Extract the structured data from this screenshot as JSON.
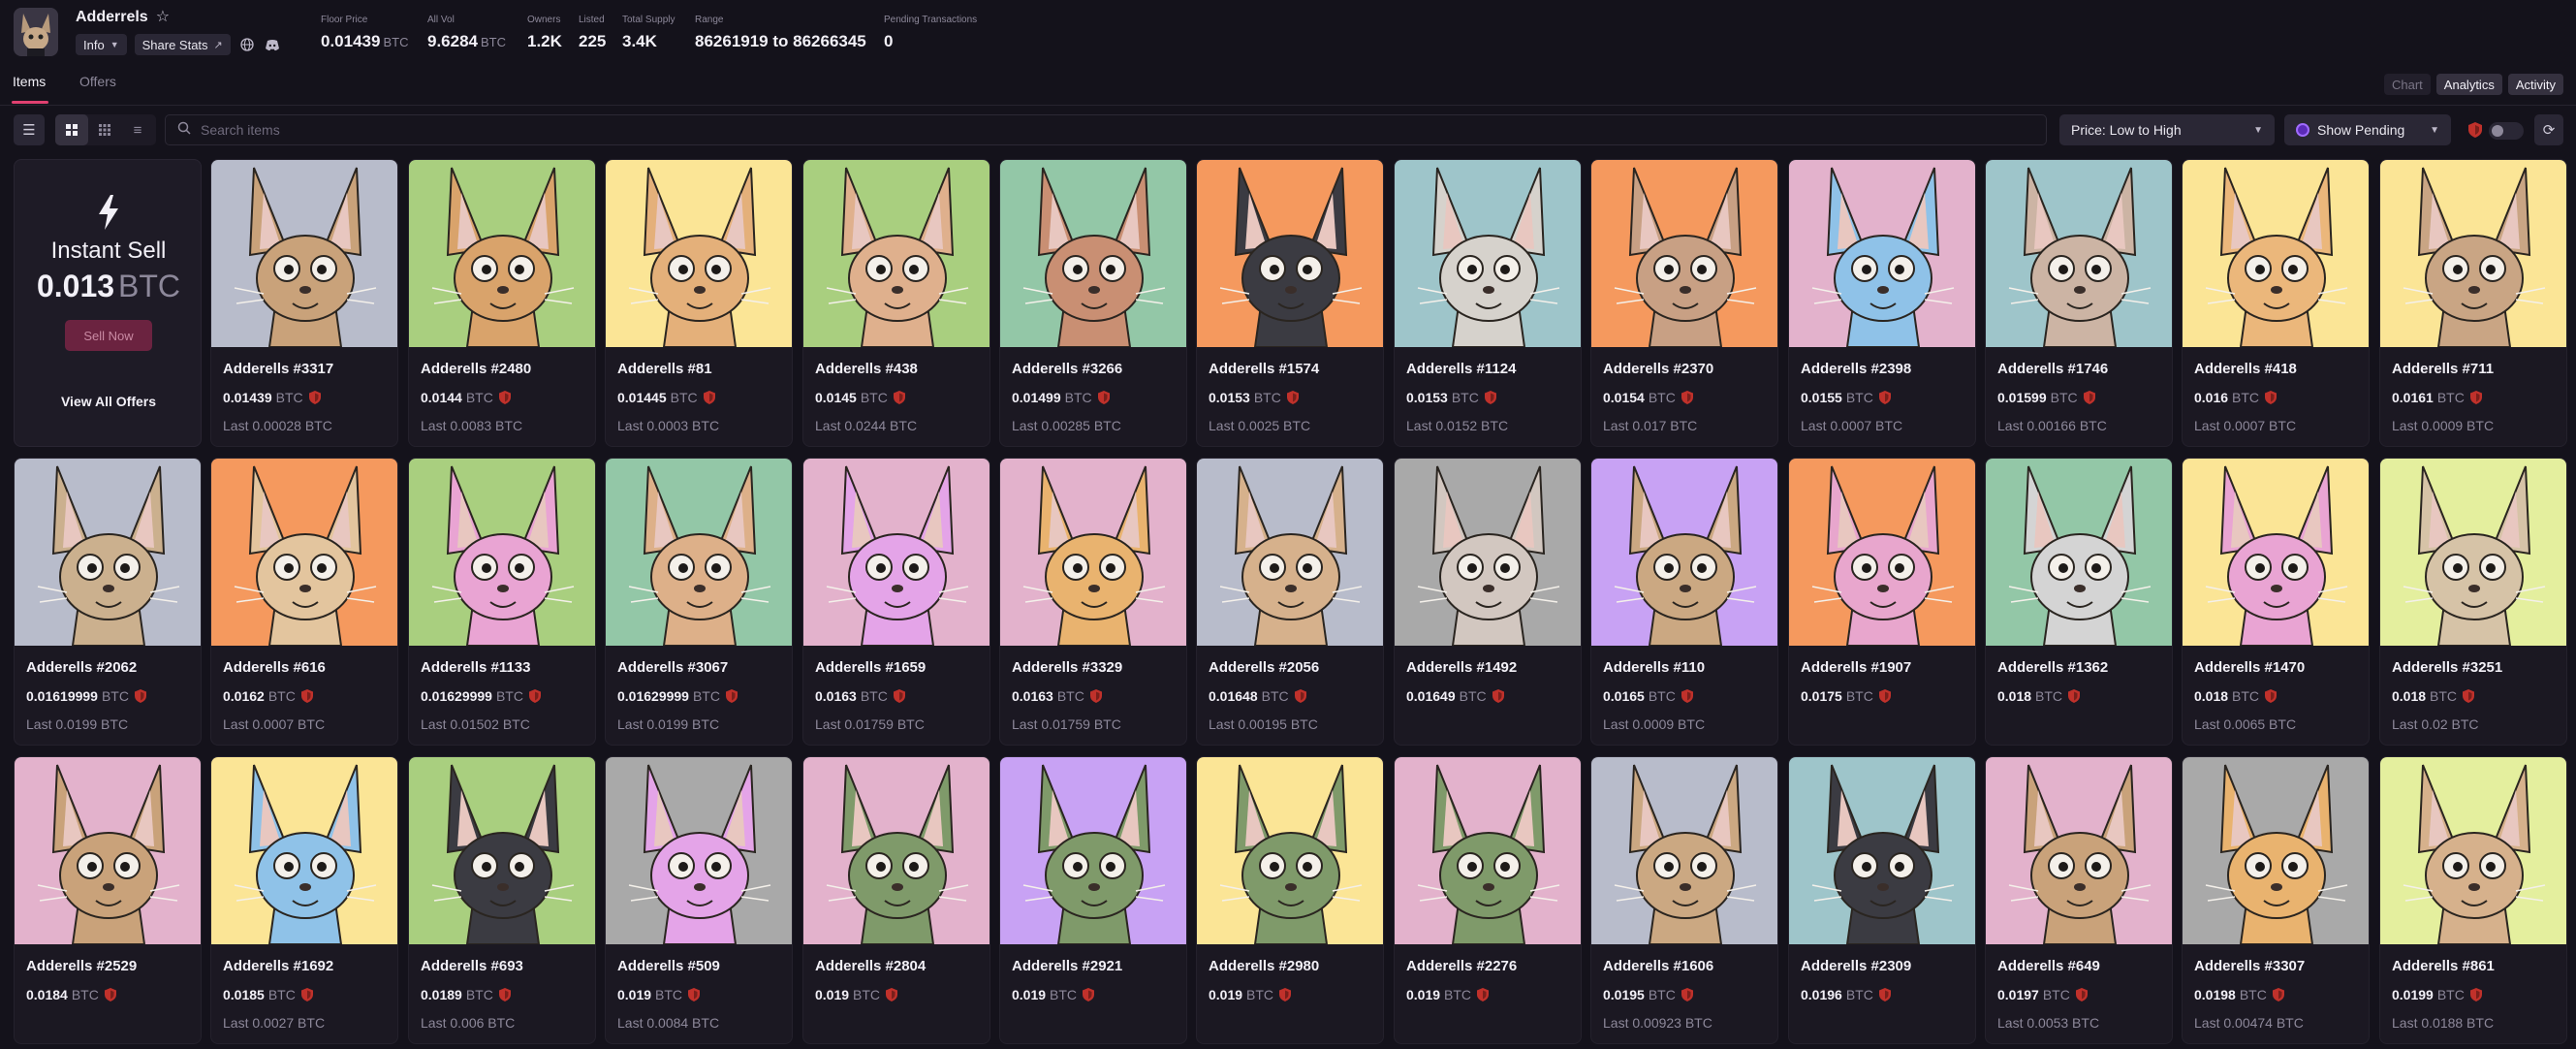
{
  "collection": {
    "name": "Adderrels",
    "info_label": "Info",
    "share_label": "Share Stats"
  },
  "stats": [
    {
      "label": "Floor Price",
      "value": "0.01439",
      "unit": "BTC"
    },
    {
      "label": "All Vol",
      "value": "9.6284",
      "unit": "BTC"
    },
    {
      "label": "Owners",
      "value": "1.2K",
      "unit": ""
    },
    {
      "label": "Listed",
      "value": "225",
      "unit": ""
    },
    {
      "label": "Total Supply",
      "value": "3.4K",
      "unit": ""
    },
    {
      "label": "Range",
      "value": "86261919 to 86266345",
      "unit": ""
    },
    {
      "label": "Pending Transactions",
      "value": "0",
      "unit": ""
    }
  ],
  "tabs": [
    {
      "label": "Items"
    },
    {
      "label": "Offers"
    }
  ],
  "view_tabs": [
    {
      "label": "Chart"
    },
    {
      "label": "Analytics"
    },
    {
      "label": "Activity"
    }
  ],
  "search": {
    "placeholder": "Search items"
  },
  "sort_select": {
    "value": "Price: Low to High"
  },
  "pending_select": {
    "value": "Show Pending"
  },
  "instant_sell": {
    "title": "Instant Sell",
    "price": "0.013",
    "unit": "BTC",
    "button": "Sell Now",
    "link": "View All Offers"
  },
  "colors": {
    "accent": "#e04070",
    "background": "#14121b",
    "card": "#1b1822",
    "shield": "#c0312b"
  },
  "items": [
    {
      "name": "Adderells #3317",
      "price": "0.01439",
      "unit": "BTC",
      "last": "Last 0.00028 BTC",
      "bg": "#b8bccb",
      "fur": "#c9a27a"
    },
    {
      "name": "Adderells #2480",
      "price": "0.0144",
      "unit": "BTC",
      "last": "Last 0.0083 BTC",
      "bg": "#a9cf7f",
      "fur": "#d9a36b"
    },
    {
      "name": "Adderells #81",
      "price": "0.01445",
      "unit": "BTC",
      "last": "Last 0.0003 BTC",
      "bg": "#fbe596",
      "fur": "#e4b07a"
    },
    {
      "name": "Adderells #438",
      "price": "0.0145",
      "unit": "BTC",
      "last": "Last 0.0244 BTC",
      "bg": "#a9cf7f",
      "fur": "#dfb08d"
    },
    {
      "name": "Adderells #3266",
      "price": "0.01499",
      "unit": "BTC",
      "last": "Last 0.00285 BTC",
      "bg": "#93c7a7",
      "fur": "#c98f73"
    },
    {
      "name": "Adderells #1574",
      "price": "0.0153",
      "unit": "BTC",
      "last": "Last 0.0025 BTC",
      "bg": "#f5995e",
      "fur": "#3b3b42"
    },
    {
      "name": "Adderells #1124",
      "price": "0.0153",
      "unit": "BTC",
      "last": "Last 0.0152 BTC",
      "bg": "#9ec5ca",
      "fur": "#d6d2cc"
    },
    {
      "name": "Adderells #2370",
      "price": "0.0154",
      "unit": "BTC",
      "last": "Last 0.017 BTC",
      "bg": "#f5995e",
      "fur": "#c8a084"
    },
    {
      "name": "Adderells #2398",
      "price": "0.0155",
      "unit": "BTC",
      "last": "Last 0.0007 BTC",
      "bg": "#e3b2cc",
      "fur": "#8fc2e8"
    },
    {
      "name": "Adderells #1746",
      "price": "0.01599",
      "unit": "BTC",
      "last": "Last 0.00166 BTC",
      "bg": "#9ec5ca",
      "fur": "#ccb4a4"
    },
    {
      "name": "Adderells #418",
      "price": "0.016",
      "unit": "BTC",
      "last": "Last 0.0007 BTC",
      "bg": "#fbe596",
      "fur": "#ebb77b"
    },
    {
      "name": "Adderells #711",
      "price": "0.0161",
      "unit": "BTC",
      "last": "Last 0.0009 BTC",
      "bg": "#fbe596",
      "fur": "#c9a584"
    },
    {
      "name": "Adderells #2062",
      "price": "0.01619999",
      "unit": "BTC",
      "last": "Last 0.0199 BTC",
      "bg": "#b8bccb",
      "fur": "#cbb08e"
    },
    {
      "name": "Adderells #616",
      "price": "0.0162",
      "unit": "BTC",
      "last": "Last 0.0007 BTC",
      "bg": "#f5995e",
      "fur": "#e3c59e"
    },
    {
      "name": "Adderells #1133",
      "price": "0.01629999",
      "unit": "BTC",
      "last": "Last 0.01502 BTC",
      "bg": "#a9cf7f",
      "fur": "#e9a4d3"
    },
    {
      "name": "Adderells #3067",
      "price": "0.01629999",
      "unit": "BTC",
      "last": "Last 0.0199 BTC",
      "bg": "#93c7a7",
      "fur": "#ddb089"
    },
    {
      "name": "Adderells #1659",
      "price": "0.0163",
      "unit": "BTC",
      "last": "Last 0.01759 BTC",
      "bg": "#e3b2cc",
      "fur": "#e4a4e8"
    },
    {
      "name": "Adderells #3329",
      "price": "0.0163",
      "unit": "BTC",
      "last": "Last 0.01759 BTC",
      "bg": "#e3b2cc",
      "fur": "#e9b36f"
    },
    {
      "name": "Adderells #2056",
      "price": "0.01648",
      "unit": "BTC",
      "last": "Last 0.00195 BTC",
      "bg": "#b8bccb",
      "fur": "#d6b18c"
    },
    {
      "name": "Adderells #1492",
      "price": "0.01649",
      "unit": "BTC",
      "last": "",
      "bg": "#a9a9a9",
      "fur": "#d2c7c0"
    },
    {
      "name": "Adderells #110",
      "price": "0.0165",
      "unit": "BTC",
      "last": "Last 0.0009 BTC",
      "bg": "#c8a2f4",
      "fur": "#cba882"
    },
    {
      "name": "Adderells #1907",
      "price": "0.0175",
      "unit": "BTC",
      "last": "",
      "bg": "#f5995e",
      "fur": "#e8a6cd"
    },
    {
      "name": "Adderells #1362",
      "price": "0.018",
      "unit": "BTC",
      "last": "",
      "bg": "#93c7a7",
      "fur": "#d4d4d4"
    },
    {
      "name": "Adderells #1470",
      "price": "0.018",
      "unit": "BTC",
      "last": "Last 0.0065 BTC",
      "bg": "#fbe596",
      "fur": "#e9a4d3"
    },
    {
      "name": "Adderells #3251",
      "price": "0.018",
      "unit": "BTC",
      "last": "Last 0.02 BTC",
      "bg": "#e4ef9e",
      "fur": "#d6c3a7"
    },
    {
      "name": "Adderells #2529",
      "price": "0.0184",
      "unit": "BTC",
      "last": "",
      "bg": "#e3b2cc",
      "fur": "#c9a27a"
    },
    {
      "name": "Adderells #1692",
      "price": "0.0185",
      "unit": "BTC",
      "last": "Last 0.0027 BTC",
      "bg": "#fbe596",
      "fur": "#8fc2e8"
    },
    {
      "name": "Adderells #693",
      "price": "0.0189",
      "unit": "BTC",
      "last": "Last 0.006 BTC",
      "bg": "#a9cf7f",
      "fur": "#3b3b42"
    },
    {
      "name": "Adderells #509",
      "price": "0.019",
      "unit": "BTC",
      "last": "Last 0.0084 BTC",
      "bg": "#a9a9a9",
      "fur": "#e4a4e8"
    },
    {
      "name": "Adderells #2804",
      "price": "0.019",
      "unit": "BTC",
      "last": "",
      "bg": "#e3b2cc",
      "fur": "#7f9a6a"
    },
    {
      "name": "Adderells #2921",
      "price": "0.019",
      "unit": "BTC",
      "last": "",
      "bg": "#c8a2f4",
      "fur": "#7f9a6a"
    },
    {
      "name": "Adderells #2980",
      "price": "0.019",
      "unit": "BTC",
      "last": "",
      "bg": "#fbe596",
      "fur": "#7f9a6a"
    },
    {
      "name": "Adderells #2276",
      "price": "0.019",
      "unit": "BTC",
      "last": "",
      "bg": "#e3b2cc",
      "fur": "#7f9a6a"
    },
    {
      "name": "Adderells #1606",
      "price": "0.0195",
      "unit": "BTC",
      "last": "Last 0.00923 BTC",
      "bg": "#b8bccb",
      "fur": "#cba882"
    },
    {
      "name": "Adderells #2309",
      "price": "0.0196",
      "unit": "BTC",
      "last": "",
      "bg": "#9ec5ca",
      "fur": "#3b3b42"
    },
    {
      "name": "Adderells #649",
      "price": "0.0197",
      "unit": "BTC",
      "last": "Last 0.0053 BTC",
      "bg": "#e3b2cc",
      "fur": "#c9a27a"
    },
    {
      "name": "Adderells #3307",
      "price": "0.0198",
      "unit": "BTC",
      "last": "Last 0.00474 BTC",
      "bg": "#a9a9a9",
      "fur": "#e9b36f"
    },
    {
      "name": "Adderells #861",
      "price": "0.0199",
      "unit": "BTC",
      "last": "Last 0.0188 BTC",
      "bg": "#e4ef9e",
      "fur": "#d6b18c"
    }
  ]
}
